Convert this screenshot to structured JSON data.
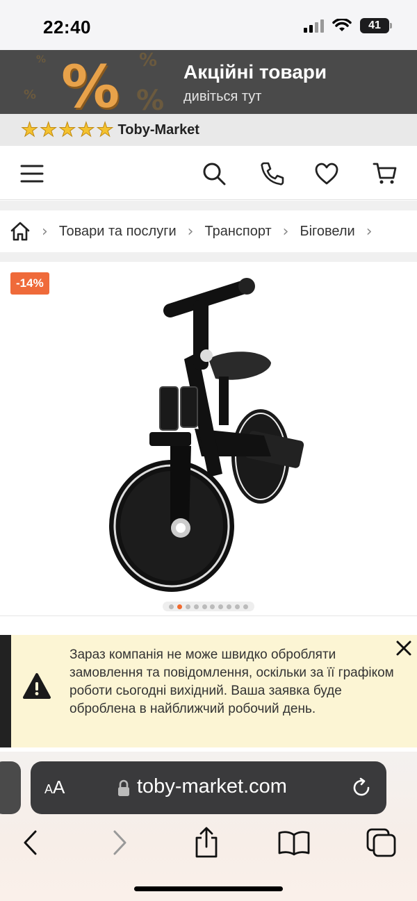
{
  "status_bar": {
    "time": "22:40",
    "battery": "41"
  },
  "promo": {
    "title": "Акційні товари",
    "subtitle": "дивіться тут",
    "symbol": "%"
  },
  "rating": {
    "stars": 5,
    "store_name": "Toby-Market"
  },
  "header": {
    "icons": [
      "menu-icon",
      "search-icon",
      "phone-icon",
      "heart-icon",
      "cart-icon"
    ]
  },
  "breadcrumb": {
    "items": [
      "Товари та послуги",
      "Транспорт",
      "Біговели"
    ]
  },
  "product": {
    "discount": "-14%",
    "gallery_count": 10,
    "gallery_active": 2
  },
  "notice": {
    "text": "Зараз компанія не може швидко обробляти замовлення та повідомлення, оскільки за її графіком роботи сьогодні вихідний. Ваша заявка буде оброблена в найближчий робочий день."
  },
  "browser": {
    "aa_label": "AA",
    "url": "toby-market.com"
  },
  "colors": {
    "accent": "#ef6a3a",
    "promo_bg": "#4a4a4a",
    "notice_bg": "#fcf5d4"
  }
}
